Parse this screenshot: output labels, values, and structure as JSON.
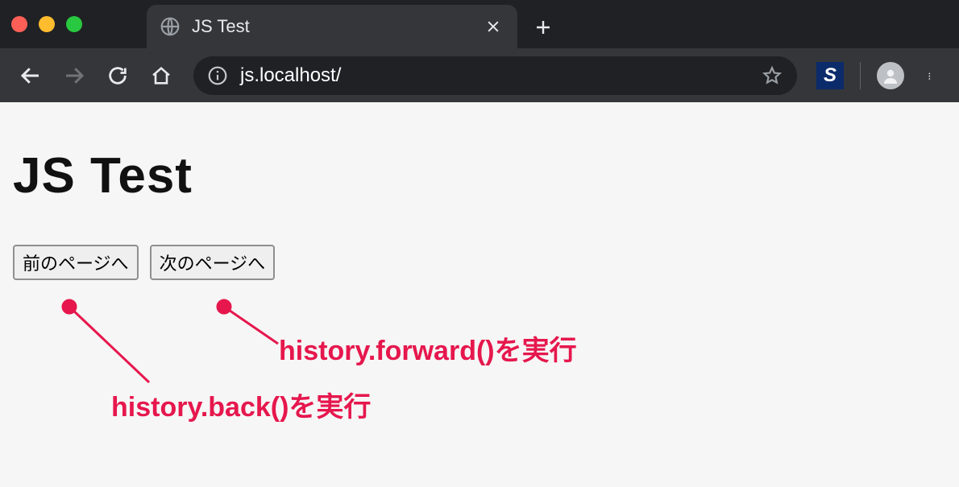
{
  "window": {
    "tab_title": "JS Test",
    "url": "js.localhost/",
    "extension_badge": "S"
  },
  "page": {
    "heading": "JS Test",
    "buttons": {
      "back_label": "前のページへ",
      "forward_label": "次のページへ"
    }
  },
  "annotations": {
    "color": "#e6174d",
    "back_note": "history.back()を実行",
    "forward_note": "history.forward()を実行"
  }
}
